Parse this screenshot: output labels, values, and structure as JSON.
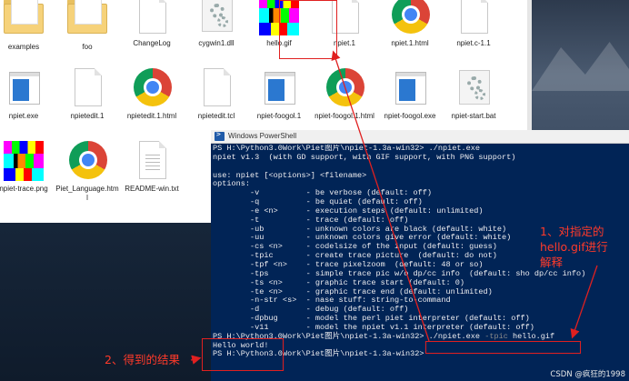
{
  "explorer": {
    "files": [
      {
        "label": "examples",
        "icon": "folder-icon"
      },
      {
        "label": "foo",
        "icon": "folder-icon"
      },
      {
        "label": "ChangeLog",
        "icon": "document-icon"
      },
      {
        "label": "cygwin1.dll",
        "icon": "gear-file-icon"
      },
      {
        "label": "hello.gif",
        "icon": "gif-image-icon"
      },
      {
        "label": "npiet.1",
        "icon": "document-icon"
      },
      {
        "label": "npiet.1.html",
        "icon": "chrome-icon"
      },
      {
        "label": "npiet.c-1.1",
        "icon": "document-icon"
      },
      {
        "label": "npiet.exe",
        "icon": "exe-icon"
      },
      {
        "label": "npietedit.1",
        "icon": "document-icon"
      },
      {
        "label": "npietedit.1.html",
        "icon": "chrome-icon"
      },
      {
        "label": "npietedit.tcl",
        "icon": "document-icon"
      },
      {
        "label": "npiet-foogol.1",
        "icon": "exe-icon"
      },
      {
        "label": "npiet-foogol.1.html",
        "icon": "chrome-icon"
      },
      {
        "label": "npiet-foogol.exe",
        "icon": "exe-icon"
      },
      {
        "label": "npiet-start.bat",
        "icon": "gear-file-icon"
      },
      {
        "label": "npiet-trace.png",
        "icon": "png-image-icon"
      },
      {
        "label": "Piet_Language.html",
        "icon": "chrome-icon"
      },
      {
        "label": "README-win.txt",
        "icon": "text-file-icon"
      }
    ]
  },
  "powershell": {
    "title": "Windows PowerShell",
    "lines": [
      "PS H:\\Python3.0Work\\Piet图片\\npiet-1.3a-win32> ./npiet.exe",
      "npiet v1.3  (with GD support, with GIF support, with PNG support)",
      "",
      "use: npiet [<options>] <filename>",
      "options:",
      "        -v          - be verbose (default: off)",
      "        -q          - be quiet (default: off)",
      "        -e <n>      - execution steps (default: unlimited)",
      "        -t          - trace (default: off)",
      "        -ub         - unknown colors are black (default: white)",
      "        -uu         - unknown colors give error (default: white)",
      "        -cs <n>     - codelsize of the input (default: guess)",
      "        -tpic       - create trace picture  (default: do not)",
      "        -tpf <n>    - trace pixelzoom  (default: 48 or so)",
      "        -tps        - simple trace pic w/o dp/cc info  (default: sho dp/cc info)",
      "        -ts <n>     - graphic trace start (default: 0)",
      "        -te <n>     - graphic trace end (default: unlimited)",
      "        -n-str <s>  - nase stuff: string-to-command",
      "        -d          - debug (default: off)",
      "        -dpbug      - model the perl piet interpreter (default: off)",
      "        -v11        - model the npiet v1.1 interpreter (default: off)"
    ],
    "prompt2": "PS H:\\Python3.0Work\\Piet图片\\npiet-1.3a-win32> ",
    "cmd_exe": "./npiet.exe ",
    "cmd_flag": "-tpic",
    "cmd_file": " hello.gif",
    "output1": "Hello world!",
    "prompt3": "PS H:\\Python3.0Work\\Piet图片\\npiet-1.3a-win32>"
  },
  "annotations": {
    "step1": "1、对指定的hello.gif进行解释",
    "step1_line1": "1、对指定的",
    "step1_line2": "hello.gif进行",
    "step1_line3": "解释",
    "step2": "2、得到的结果",
    "color": "#e02020"
  },
  "watermark": "CSDN @疯狂的1998"
}
